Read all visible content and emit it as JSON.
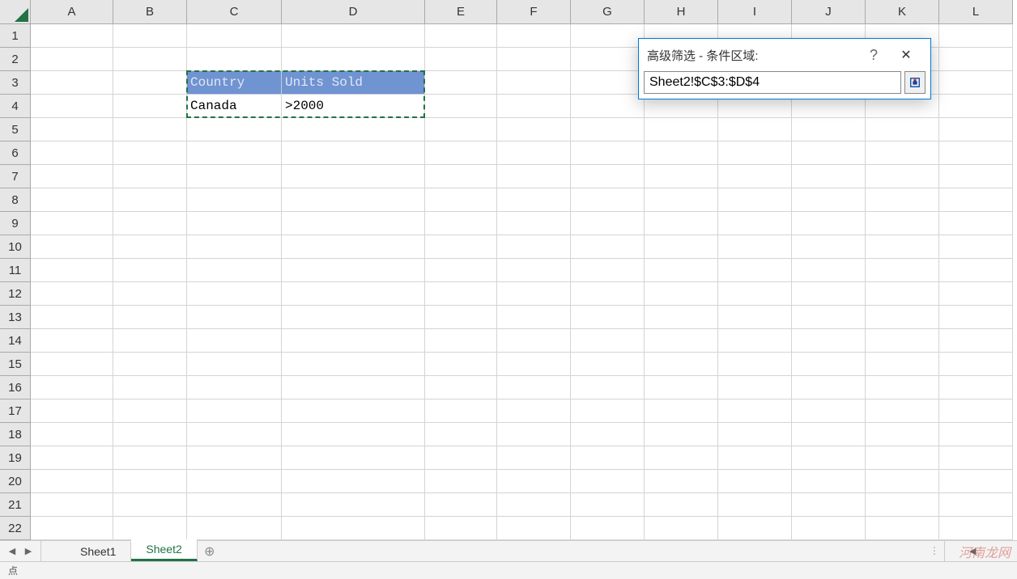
{
  "columns": [
    {
      "label": "A",
      "width": 102
    },
    {
      "label": "B",
      "width": 91
    },
    {
      "label": "C",
      "width": 117
    },
    {
      "label": "D",
      "width": 177
    },
    {
      "label": "E",
      "width": 89
    },
    {
      "label": "F",
      "width": 91
    },
    {
      "label": "G",
      "width": 91
    },
    {
      "label": "H",
      "width": 91
    },
    {
      "label": "I",
      "width": 91
    },
    {
      "label": "J",
      "width": 91
    },
    {
      "label": "K",
      "width": 91
    },
    {
      "label": "L",
      "width": 91
    }
  ],
  "rows": [
    "1",
    "2",
    "3",
    "4",
    "5",
    "6",
    "7",
    "8",
    "9",
    "10",
    "11",
    "12",
    "13",
    "14",
    "15",
    "16",
    "17",
    "18",
    "19",
    "20",
    "21",
    "22"
  ],
  "cells": {
    "C3": {
      "value": "Country",
      "header": true
    },
    "D3": {
      "value": "Units Sold",
      "header": true
    },
    "C4": {
      "value": "Canada"
    },
    "D4": {
      "value": ">2000"
    }
  },
  "selection": {
    "range": "C3:D4"
  },
  "dialog": {
    "title": "高级筛选 - 条件区域:",
    "value": "Sheet2!$C$3:$D$4",
    "help": "?",
    "close": "✕"
  },
  "tabs": [
    {
      "label": "Sheet1",
      "active": false
    },
    {
      "label": "Sheet2",
      "active": true
    }
  ],
  "add_sheet": "⊕",
  "status": "点",
  "watermark": "河南龙网"
}
